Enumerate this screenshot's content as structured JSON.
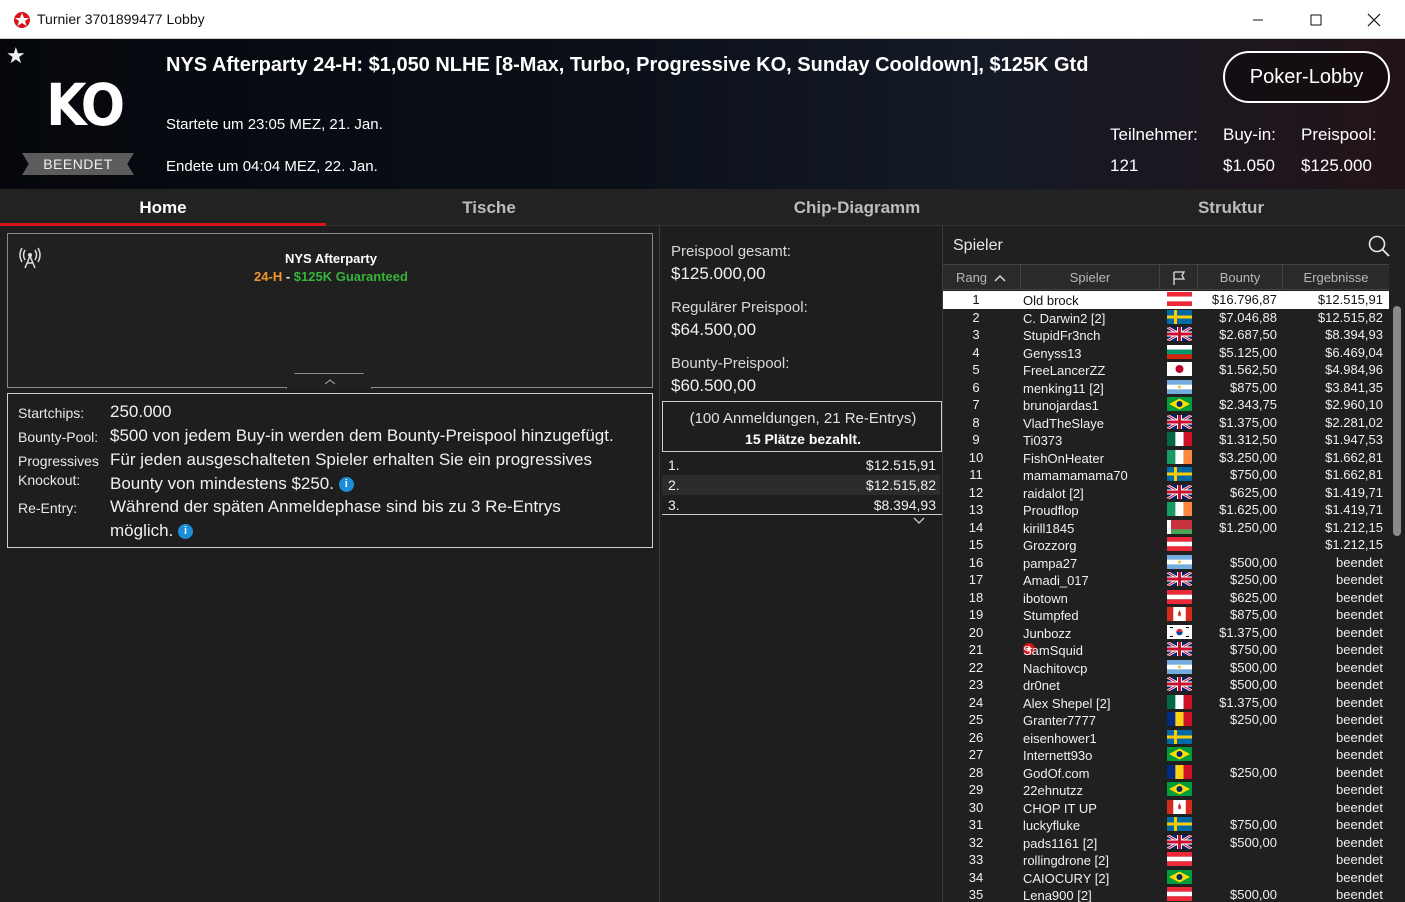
{
  "window": {
    "title": "Turnier 3701899477 Lobby"
  },
  "header": {
    "badge": "BEENDET",
    "logo_text": "KO",
    "title": "NYS Afterparty 24-H: $1,050 NLHE [8-Max, Turbo, Progressive KO, Sunday Cooldown], $125K Gtd",
    "started": "Startete um 23:05 MEZ, 21. Jan.",
    "ended": "Endete um 04:04 MEZ, 22. Jan.",
    "lobby_button": "Poker-Lobby",
    "stats": {
      "participants_label": "Teilnehmer:",
      "participants": "121",
      "buyin_label": "Buy-in:",
      "buyin": "$1.050",
      "prizepool_label": "Preispool:",
      "prizepool": "$125.000"
    }
  },
  "tabs": [
    "Home",
    "Tische",
    "Chip-Diagramm",
    "Struktur"
  ],
  "banner": {
    "name": "NYS Afterparty",
    "sub_orange": "24-H",
    "sub_sep": " - ",
    "sub_green": "$125K Guaranteed",
    "colors": {
      "orange": "#f0962e",
      "green": "#35b43a"
    }
  },
  "details": {
    "startchips_label": "Startchips:",
    "startchips": "250.000",
    "bountypool_label": "Bounty-Pool:",
    "bountypool": "$500 von jedem Buy-in werden dem Bounty-Preispool hinzugefügt.",
    "pko_label_1": "Progressives",
    "pko_label_2": "Knockout:",
    "pko_line1": "Für jeden ausgeschalteten Spieler erhalten Sie ein progressives",
    "pko_line2": "Bounty von mindestens $250.",
    "reentry_label": "Re-Entry:",
    "reentry_line1": "Während der späten Anmeldephase sind bis zu 3 Re-Entrys",
    "reentry_line2": "möglich."
  },
  "prizepool": {
    "total_label": "Preispool gesamt:",
    "total": "$125.000,00",
    "regular_label": "Regulärer Preispool:",
    "regular": "$64.500,00",
    "bounty_label": "Bounty-Preispool:",
    "bounty": "$60.500,00",
    "registrations": "(100 Anmeldungen, 21 Re-Entrys)",
    "paid": "15 Plätze bezahlt.",
    "payouts": [
      {
        "rank": "1.",
        "amount": "$12.515,91"
      },
      {
        "rank": "2.",
        "amount": "$12.515,82"
      },
      {
        "rank": "3.",
        "amount": "$8.394,93"
      }
    ]
  },
  "players": {
    "search_label": "Spieler",
    "columns": {
      "rank": "Rang",
      "name": "Spieler",
      "bounty": "Bounty",
      "result": "Ergebnisse"
    },
    "rows": [
      {
        "rank": "1",
        "name": "Old brock",
        "flag": "AT",
        "bounty": "$16.796,87",
        "result": "$12.515,91"
      },
      {
        "rank": "2",
        "name": "C. Darwin2 [2]",
        "flag": "SE",
        "bounty": "$7.046,88",
        "result": "$12.515,82"
      },
      {
        "rank": "3",
        "name": "StupidFr3nch",
        "flag": "GB",
        "bounty": "$2.687,50",
        "result": "$8.394,93"
      },
      {
        "rank": "4",
        "name": "Genyss13",
        "flag": "BG",
        "bounty": "$5.125,00",
        "result": "$6.469,04"
      },
      {
        "rank": "5",
        "name": "FreeLancerZZ",
        "flag": "JP",
        "bounty": "$1.562,50",
        "result": "$4.984,96"
      },
      {
        "rank": "6",
        "name": "menking11 [2]",
        "flag": "AR",
        "bounty": "$875,00",
        "result": "$3.841,35"
      },
      {
        "rank": "7",
        "name": "brunojardas1",
        "flag": "BR",
        "bounty": "$2.343,75",
        "result": "$2.960,10"
      },
      {
        "rank": "8",
        "name": "VladTheSlaye",
        "flag": "GB",
        "bounty": "$1.375,00",
        "result": "$2.281,02"
      },
      {
        "rank": "9",
        "name": "Ti0373",
        "flag": "MX",
        "bounty": "$1.312,50",
        "result": "$1.947,53"
      },
      {
        "rank": "10",
        "name": "FishOnHeater",
        "flag": "IE",
        "bounty": "$3.250,00",
        "result": "$1.662,81"
      },
      {
        "rank": "11",
        "name": "mamamamama70",
        "flag": "SE",
        "bounty": "$750,00",
        "result": "$1.662,81"
      },
      {
        "rank": "12",
        "name": "raidalot [2]",
        "flag": "GB",
        "bounty": "$625,00",
        "result": "$1.419,71"
      },
      {
        "rank": "13",
        "name": "Proudflop",
        "flag": "IE",
        "bounty": "$1.625,00",
        "result": "$1.419,71"
      },
      {
        "rank": "14",
        "name": "kirill1845",
        "flag": "BY",
        "bounty": "$1.250,00",
        "result": "$1.212,15"
      },
      {
        "rank": "15",
        "name": "Grozzorg",
        "flag": "AT",
        "bounty": "",
        "result": "$1.212,15"
      },
      {
        "rank": "16",
        "name": "pampa27",
        "flag": "AR",
        "bounty": "$500,00",
        "result": "beendet"
      },
      {
        "rank": "17",
        "name": "Amadi_017",
        "flag": "GB",
        "bounty": "$250,00",
        "result": "beendet"
      },
      {
        "rank": "18",
        "name": "ibotown",
        "flag": "AT",
        "bounty": "$625,00",
        "result": "beendet"
      },
      {
        "rank": "19",
        "name": "Stumpfed",
        "flag": "CA",
        "bounty": "$875,00",
        "result": "beendet"
      },
      {
        "rank": "20",
        "name": "Junbozz",
        "flag": "KR",
        "bounty": "$1.375,00",
        "result": "beendet"
      },
      {
        "rank": "21",
        "name": "SamSquid",
        "flag": "GB",
        "bounty": "$750,00",
        "result": "beendet",
        "star": true
      },
      {
        "rank": "22",
        "name": "Nachitovcp",
        "flag": "AR",
        "bounty": "$500,00",
        "result": "beendet"
      },
      {
        "rank": "23",
        "name": "dr0net",
        "flag": "GB",
        "bounty": "$500,00",
        "result": "beendet"
      },
      {
        "rank": "24",
        "name": "Alex Shepel [2]",
        "flag": "MX",
        "bounty": "$1.375,00",
        "result": "beendet"
      },
      {
        "rank": "25",
        "name": "Granter7777",
        "flag": "RO",
        "bounty": "$250,00",
        "result": "beendet"
      },
      {
        "rank": "26",
        "name": "eisenhower1",
        "flag": "SE",
        "bounty": "",
        "result": "beendet"
      },
      {
        "rank": "27",
        "name": "Internett93o",
        "flag": "BR",
        "bounty": "",
        "result": "beendet"
      },
      {
        "rank": "28",
        "name": "GodOf.com",
        "flag": "RO",
        "bounty": "$250,00",
        "result": "beendet"
      },
      {
        "rank": "29",
        "name": "22ehnutzz",
        "flag": "BR",
        "bounty": "",
        "result": "beendet"
      },
      {
        "rank": "30",
        "name": "CHOP IT UP",
        "flag": "CA",
        "bounty": "",
        "result": "beendet"
      },
      {
        "rank": "31",
        "name": "luckyfluke",
        "flag": "SE",
        "bounty": "$750,00",
        "result": "beendet"
      },
      {
        "rank": "32",
        "name": "pads1161 [2]",
        "flag": "GB",
        "bounty": "$500,00",
        "result": "beendet"
      },
      {
        "rank": "33",
        "name": "rollingdrone [2]",
        "flag": "AT",
        "bounty": "",
        "result": "beendet"
      },
      {
        "rank": "34",
        "name": "CAIOCURY [2]",
        "flag": "BR",
        "bounty": "",
        "result": "beendet"
      },
      {
        "rank": "35",
        "name": "Lena900 [2]",
        "flag": "AT",
        "bounty": "$500,00",
        "result": "beendet"
      }
    ]
  },
  "icons": {
    "app": "pokerstars-icon",
    "favorite": "star-icon",
    "live": "broadcast-icon",
    "search": "search-icon",
    "flag_column": "flag-icon",
    "sort": "chevron-up-icon",
    "info": "info-icon"
  },
  "colors": {
    "accent_red": "#d7141a",
    "info_blue": "#1a8ed8",
    "background": "#1e1e1e"
  }
}
